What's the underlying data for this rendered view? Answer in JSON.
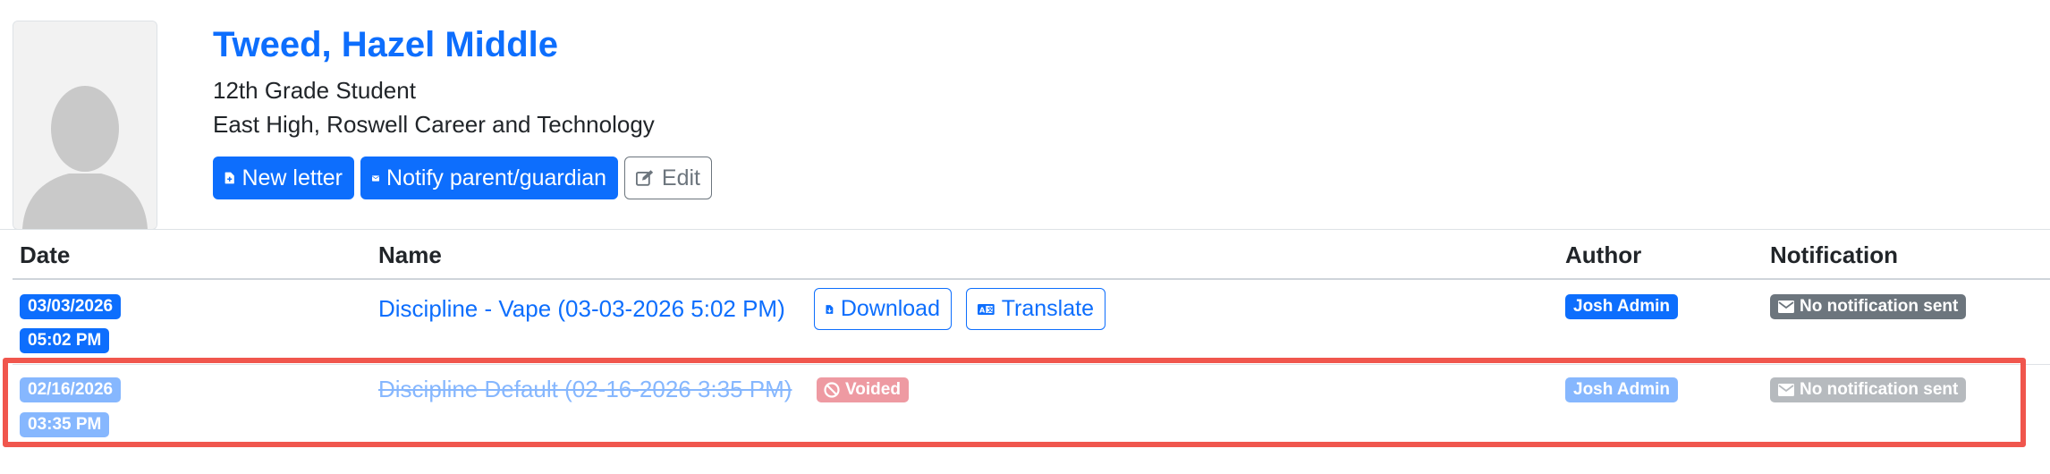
{
  "student": {
    "name": "Tweed, Hazel Middle",
    "grade": "12th Grade Student",
    "schools": "East High, Roswell Career and Technology"
  },
  "actions": {
    "new_letter": "New letter",
    "notify": "Notify parent/guardian",
    "edit": "Edit"
  },
  "table": {
    "headers": {
      "date": "Date",
      "name": "Name",
      "author": "Author",
      "notification": "Notification"
    },
    "rows": [
      {
        "date": "03/03/2026",
        "time": "05:02 PM",
        "name": "Discipline - Vape (03-03-2026 5:02 PM)",
        "download": "Download",
        "translate": "Translate",
        "author": "Josh Admin",
        "notification": "No notification sent",
        "voided": false
      },
      {
        "date": "02/16/2026",
        "time": "03:35 PM",
        "name": "Discipline Default (02-16-2026 3:35 PM)",
        "status": "Voided",
        "author": "Josh Admin",
        "notification": "No notification sent",
        "voided": true
      }
    ]
  },
  "colors": {
    "primary": "#0d6efd",
    "secondary": "#6c757d",
    "danger": "#dc3545",
    "highlight": "#f0564d"
  }
}
